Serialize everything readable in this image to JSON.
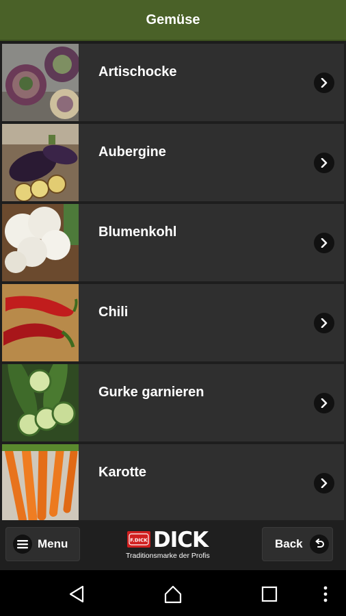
{
  "header": {
    "title": "Gemüse"
  },
  "items": [
    {
      "label": "Artischocke",
      "icon": "artichoke-image"
    },
    {
      "label": "Aubergine",
      "icon": "eggplant-image"
    },
    {
      "label": "Blumenkohl",
      "icon": "cauliflower-image"
    },
    {
      "label": "Chili",
      "icon": "chili-image"
    },
    {
      "label": "Gurke garnieren",
      "icon": "cucumber-image"
    },
    {
      "label": "Karotte",
      "icon": "carrot-image"
    }
  ],
  "footer": {
    "menu_label": "Menu",
    "back_label": "Back",
    "brand": "DICK",
    "brand_mark": "F.DICK",
    "tagline": "Traditionsmarke der Profis"
  },
  "colors": {
    "header_bg": "#4a6128",
    "item_bg": "#2f2f2f",
    "brand_red": "#d01f1f"
  }
}
